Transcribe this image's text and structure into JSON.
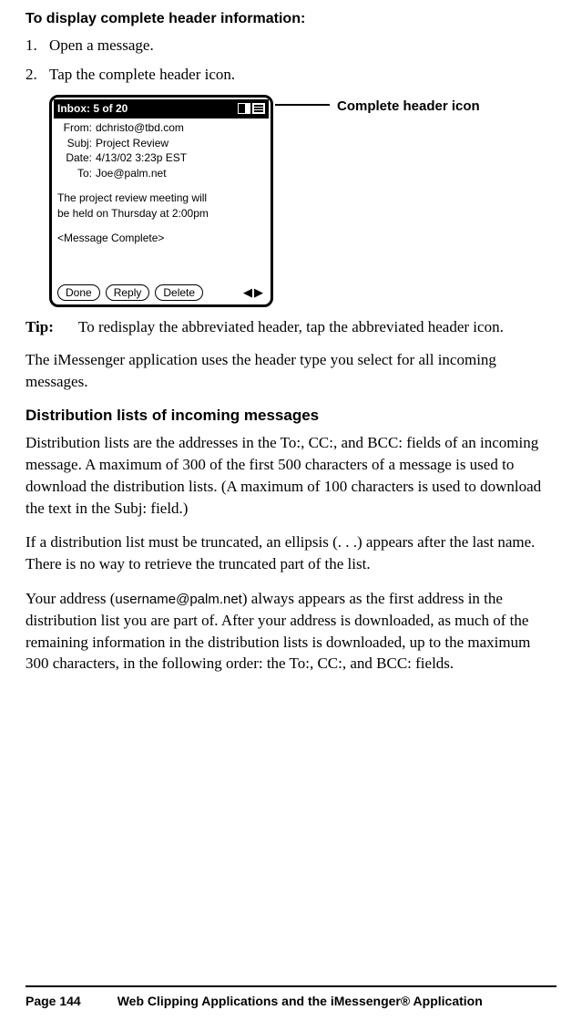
{
  "headings": {
    "procedure": "To display complete header information:",
    "distribution": "Distribution lists of incoming messages"
  },
  "steps": {
    "s1_num": "1.",
    "s1_text": "Open a message.",
    "s2_num": "2.",
    "s2_text": "Tap the complete header icon."
  },
  "device": {
    "title": "Inbox: 5 of 20",
    "from_label": "From:",
    "from_value": "dchristo@tbd.com",
    "subj_label": "Subj:",
    "subj_value": "Project Review",
    "date_label": "Date:",
    "date_value": "4/13/02 3:23p EST",
    "to_label": "To:",
    "to_value": "Joe@palm.net",
    "body_line1": "The project review meeting will",
    "body_line2": "be held on Thursday at 2:00pm",
    "complete": "<Message Complete>",
    "btn_done": "Done",
    "btn_reply": "Reply",
    "btn_delete": "Delete"
  },
  "callout": {
    "header_icon": "Complete header icon"
  },
  "tip": {
    "label": "Tip:",
    "text": "To redisplay the abbreviated header, tap the abbreviated header icon."
  },
  "paragraphs": {
    "p1": "The iMessenger application uses the header type you select for all incoming messages.",
    "p2": "Distribution lists are the addresses in the To:, CC:, and BCC: fields of an incoming message. A maximum of 300 of the first 500 characters of a message is used to download the distribution lists. (A maximum of 100 characters is used to download the text in the Subj: field.)",
    "p3": "If a distribution list must be truncated, an ellipsis (. . .) appears after the last name. There is no way to retrieve the truncated part of the list.",
    "p4_a": "Your address (",
    "p4_mono": "username@palm.net",
    "p4_b": ") always appears as the first address in the distribution list you are part of. After your address is downloaded, as much of the remaining information in the distribution lists is downloaded, up to the maximum 300 characters, in the following order: the To:, CC:, and BCC: fields."
  },
  "footer": {
    "page": "Page 144",
    "chapter": "Web Clipping Applications and the iMessenger® Application"
  }
}
